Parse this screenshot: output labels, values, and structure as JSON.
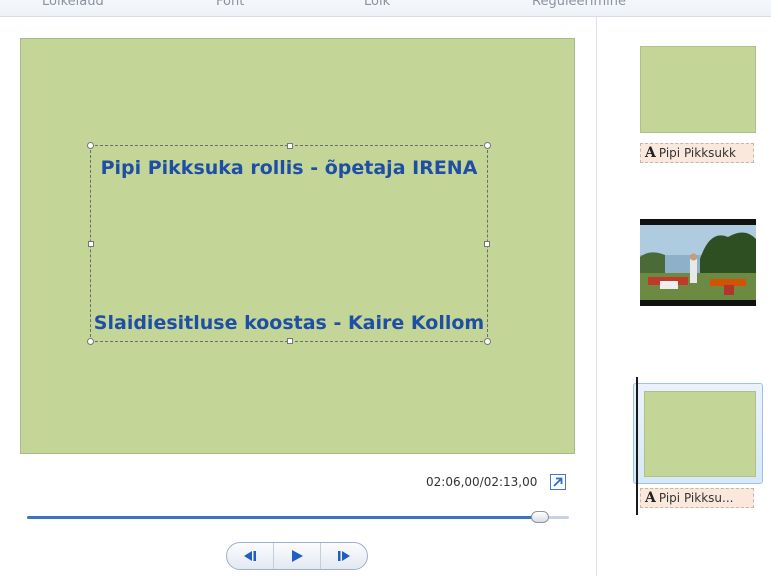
{
  "ribbon": {
    "groups": [
      "Lõikelaud",
      "Font",
      "Lõik",
      "Reguleerimine"
    ]
  },
  "preview": {
    "caption_line1": "Pipi Pikksuka rollis - õpetaja IRENA",
    "caption_line2": "Slaidiesitluse koostas - Kaire Kollom",
    "time_readout": "02:06,00/02:13,00",
    "seek_progress": 0.947
  },
  "storyboard": {
    "clips": [
      {
        "type": "title",
        "caption": "Pipi Pikksukk"
      },
      {
        "type": "video"
      },
      {
        "type": "title",
        "caption": "Pipi Pikksu..."
      }
    ]
  },
  "icons": {
    "fullscreen": "fullscreen-icon",
    "previous_frame": "previous-frame-icon",
    "play": "play-icon",
    "next_frame": "next-frame-icon",
    "caption": "text-caption-icon"
  },
  "colors": {
    "slide_background": "#c4d598",
    "caption_text": "#1f4fa4",
    "accent": "#3a74c4"
  }
}
